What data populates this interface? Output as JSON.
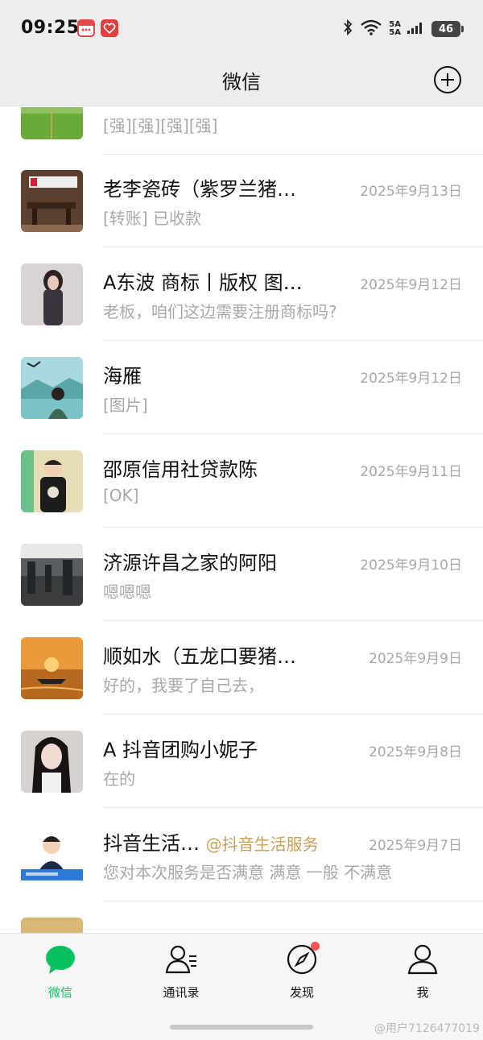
{
  "status_bar": {
    "time": "09:25",
    "network_top": "5A",
    "network_bottom": "5A",
    "battery": "46"
  },
  "title_bar": {
    "title": "微信",
    "add_icon": "plus-circle-icon"
  },
  "chats": [
    {
      "name": "",
      "time": "",
      "preview": "[强][强][强][强]"
    },
    {
      "name": "老李瓷砖（紫罗兰猪…",
      "time": "2025年9月13日",
      "preview": "[转账] 已收款"
    },
    {
      "name": "A东波 商标丨版权 图…",
      "time": "2025年9月12日",
      "preview": "老板，咱们这边需要注册商标吗?"
    },
    {
      "name": "海雁",
      "time": "2025年9月12日",
      "preview": "[图片]"
    },
    {
      "name": "邵原信用社贷款陈",
      "time": "2025年9月11日",
      "preview": "[OK]"
    },
    {
      "name": "济源许昌之家的阿阳",
      "time": "2025年9月10日",
      "preview": "嗯嗯嗯"
    },
    {
      "name": "顺如水（五龙口要猪…",
      "time": "2025年9月9日",
      "preview": "好的，我要了自己去，"
    },
    {
      "name": "A 抖音团购小妮子",
      "time": "2025年9月8日",
      "preview": "在的"
    },
    {
      "name": "抖音生活…",
      "name_tag": "@抖音生活服务",
      "time": "2025年9月7日",
      "preview": "您对本次服务是否满意 满意 一般 不满意"
    }
  ],
  "tabs": [
    {
      "label": "微信",
      "icon": "chat-bubble-icon",
      "active": true
    },
    {
      "label": "通讯录",
      "icon": "contacts-icon"
    },
    {
      "label": "发现",
      "icon": "compass-icon"
    },
    {
      "label": "我",
      "icon": "person-icon"
    }
  ],
  "watermark": "@用户7126477019",
  "colors": {
    "accent": "#07c160",
    "header_bg": "#ededed",
    "tag": "#c9a05a",
    "muted": "#a8a8a8"
  }
}
